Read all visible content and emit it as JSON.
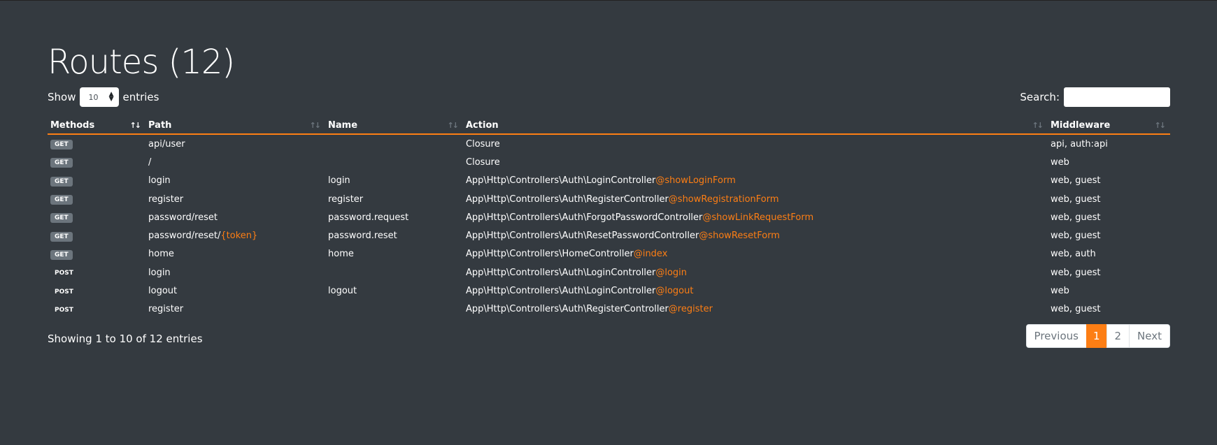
{
  "title": "Routes (12)",
  "length_menu": {
    "prefix": "Show",
    "value": "10",
    "suffix": "entries"
  },
  "search": {
    "label": "Search:",
    "value": "",
    "placeholder": ""
  },
  "columns": [
    {
      "label": "Methods",
      "sort": "↑↓",
      "active": true
    },
    {
      "label": "Path",
      "sort": "↑↓",
      "active": false
    },
    {
      "label": "Name",
      "sort": "↑↓",
      "active": false
    },
    {
      "label": "Action",
      "sort": "↑↓",
      "active": false
    },
    {
      "label": "Middleware",
      "sort": "↑↓",
      "active": false
    }
  ],
  "rows": [
    {
      "method": "GET",
      "path": "api/user",
      "path_param": "",
      "name": "",
      "action": "Closure",
      "action_method": "",
      "middleware": "api, auth:api"
    },
    {
      "method": "GET",
      "path": "/",
      "path_param": "",
      "name": "",
      "action": "Closure",
      "action_method": "",
      "middleware": "web"
    },
    {
      "method": "GET",
      "path": "login",
      "path_param": "",
      "name": "login",
      "action": "App\\Http\\Controllers\\Auth\\LoginController",
      "action_method": "@showLoginForm",
      "middleware": "web, guest"
    },
    {
      "method": "GET",
      "path": "register",
      "path_param": "",
      "name": "register",
      "action": "App\\Http\\Controllers\\Auth\\RegisterController",
      "action_method": "@showRegistrationForm",
      "middleware": "web, guest"
    },
    {
      "method": "GET",
      "path": "password/reset",
      "path_param": "",
      "name": "password.request",
      "action": "App\\Http\\Controllers\\Auth\\ForgotPasswordController",
      "action_method": "@showLinkRequestForm",
      "middleware": "web, guest"
    },
    {
      "method": "GET",
      "path": "password/reset/",
      "path_param": "{token}",
      "name": "password.reset",
      "action": "App\\Http\\Controllers\\Auth\\ResetPasswordController",
      "action_method": "@showResetForm",
      "middleware": "web, guest"
    },
    {
      "method": "GET",
      "path": "home",
      "path_param": "",
      "name": "home",
      "action": "App\\Http\\Controllers\\HomeController",
      "action_method": "@index",
      "middleware": "web, auth"
    },
    {
      "method": "POST",
      "path": "login",
      "path_param": "",
      "name": "",
      "action": "App\\Http\\Controllers\\Auth\\LoginController",
      "action_method": "@login",
      "middleware": "web, guest"
    },
    {
      "method": "POST",
      "path": "logout",
      "path_param": "",
      "name": "logout",
      "action": "App\\Http\\Controllers\\Auth\\LoginController",
      "action_method": "@logout",
      "middleware": "web"
    },
    {
      "method": "POST",
      "path": "register",
      "path_param": "",
      "name": "",
      "action": "App\\Http\\Controllers\\Auth\\RegisterController",
      "action_method": "@register",
      "middleware": "web, guest"
    }
  ],
  "info": "Showing 1 to 10 of 12 entries",
  "pagination": {
    "previous": "Previous",
    "pages": [
      "1",
      "2"
    ],
    "current": "1",
    "next": "Next"
  },
  "colors": {
    "background": "#343a40",
    "accent": "#fd7e14",
    "badge_get": "#6c757d"
  }
}
